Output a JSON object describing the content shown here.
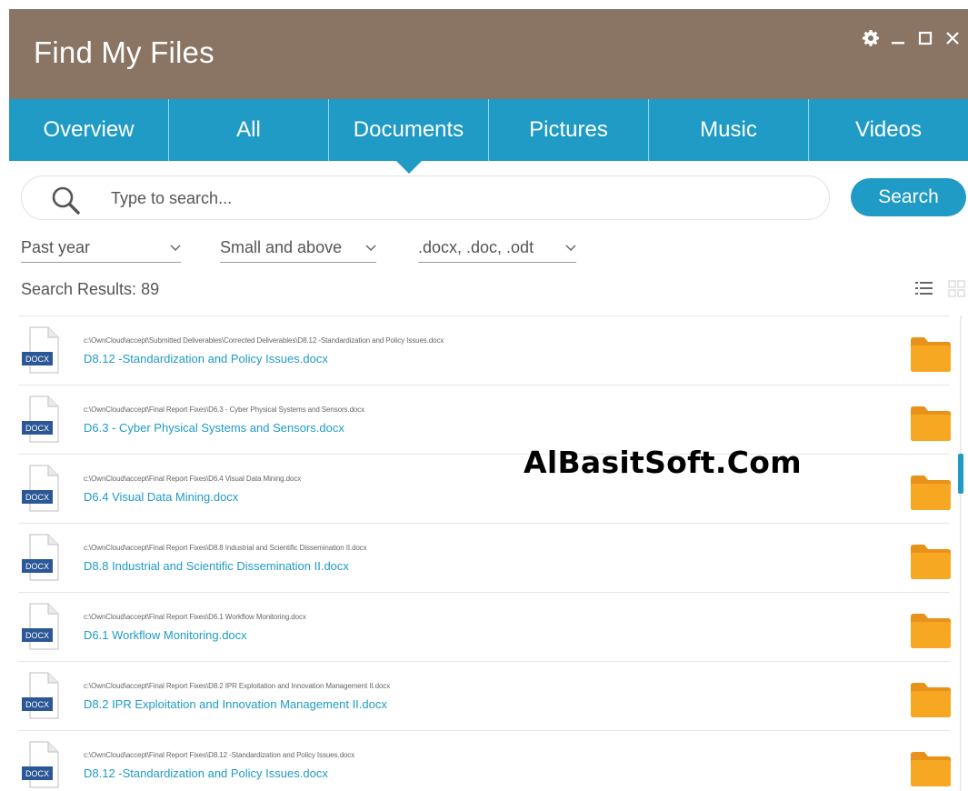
{
  "window": {
    "title": "Find My Files",
    "controls": [
      "gear-icon",
      "minimize-icon",
      "maximize-icon",
      "close-icon"
    ]
  },
  "tabs": [
    {
      "label": "Overview",
      "active": false
    },
    {
      "label": "All",
      "active": false
    },
    {
      "label": "Documents",
      "active": true
    },
    {
      "label": "Pictures",
      "active": false
    },
    {
      "label": "Music",
      "active": false
    },
    {
      "label": "Videos",
      "active": false
    }
  ],
  "search": {
    "placeholder": "Type to search...",
    "value": "",
    "button_label": "Search"
  },
  "filters": {
    "date": "Past year",
    "size": "Small and above",
    "types": ".docx, .doc, .odt"
  },
  "results": {
    "label": "Search Results:",
    "count": "89",
    "items": [
      {
        "path": "c:\\OwnCloud\\accept\\Submitted Deliverables\\Corrected Deliverables\\D8.12 -Standardization and Policy Issues.docx",
        "name": "D8.12 -Standardization and Policy Issues.docx",
        "badge": "DOCX"
      },
      {
        "path": "c:\\OwnCloud\\accept\\Final Report Fixes\\D6.3 - Cyber Physical Systems and Sensors.docx",
        "name": "D6.3 - Cyber Physical Systems and Sensors.docx",
        "badge": "DOCX"
      },
      {
        "path": "c:\\OwnCloud\\accept\\Final Report Fixes\\D6.4 Visual Data Mining.docx",
        "name": "D6.4 Visual Data Mining.docx",
        "badge": "DOCX"
      },
      {
        "path": "c:\\OwnCloud\\accept\\Final Report Fixes\\D8.8 Industrial and Scientific Dissemination II.docx",
        "name": "D8.8 Industrial and Scientific Dissemination II.docx",
        "badge": "DOCX"
      },
      {
        "path": "c:\\OwnCloud\\accept\\Final Report Fixes\\D6.1 Workflow Monitoring.docx",
        "name": "D6.1 Workflow Monitoring.docx",
        "badge": "DOCX"
      },
      {
        "path": "c:\\OwnCloud\\accept\\Final Report Fixes\\D8.2 IPR Exploitation and Innovation Management II.docx",
        "name": "D8.2 IPR Exploitation and Innovation Management II.docx",
        "badge": "DOCX"
      },
      {
        "path": "c:\\OwnCloud\\accept\\Final Report Fixes\\D8.12 -Standardization and Policy Issues.docx",
        "name": "D8.12 -Standardization and Policy Issues.docx",
        "badge": "DOCX"
      }
    ]
  },
  "watermark": "AlBasitSoft.Com",
  "colors": {
    "titlebar": "#8a7463",
    "accent": "#1f9bc6",
    "folder": "#f7a823",
    "doc_badge": "#2b5797"
  }
}
